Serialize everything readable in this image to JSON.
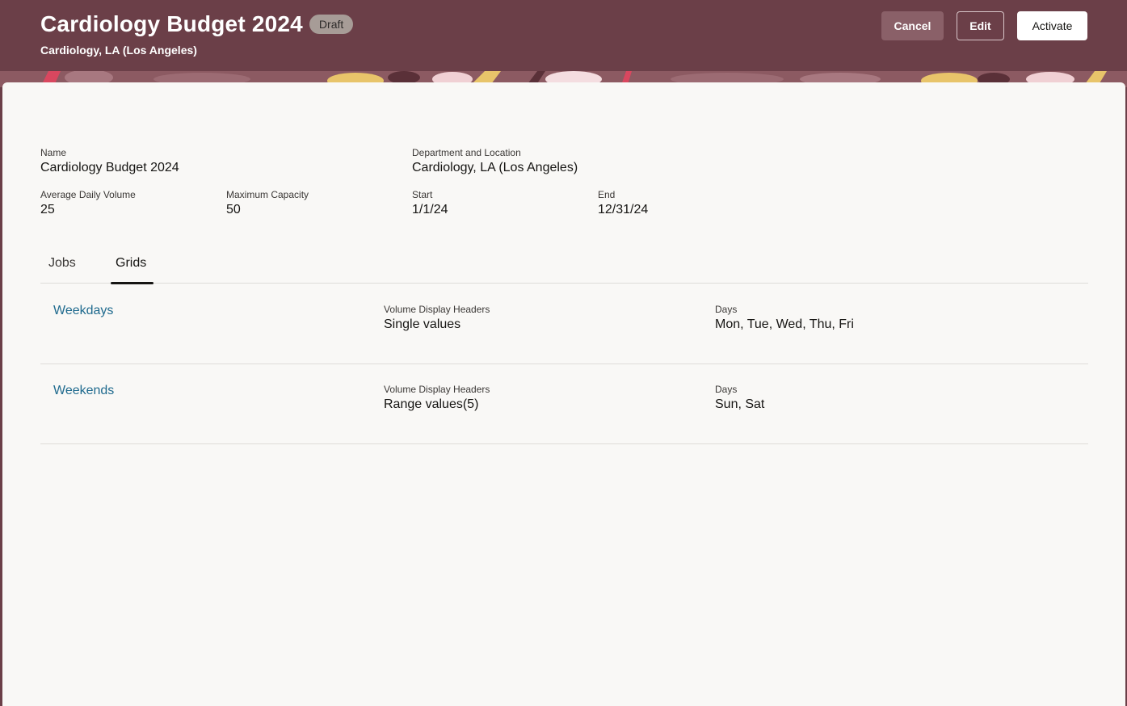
{
  "header": {
    "title": "Cardiology Budget 2024",
    "status": "Draft",
    "subtitle": "Cardiology, LA (Los Angeles)",
    "actions": {
      "cancel": "Cancel",
      "edit": "Edit",
      "activate": "Activate"
    }
  },
  "details": {
    "name": {
      "label": "Name",
      "value": "Cardiology Budget 2024"
    },
    "department": {
      "label": "Department and Location",
      "value": "Cardiology, LA (Los Angeles)"
    },
    "avg_daily_volume": {
      "label": "Average Daily Volume",
      "value": "25"
    },
    "max_capacity": {
      "label": "Maximum Capacity",
      "value": "50"
    },
    "start": {
      "label": "Start",
      "value": "1/1/24"
    },
    "end": {
      "label": "End",
      "value": "12/31/24"
    }
  },
  "tabs": [
    {
      "label": "Jobs",
      "selected": false
    },
    {
      "label": "Grids",
      "selected": true
    }
  ],
  "grids": [
    {
      "name": "Weekdays",
      "headers_label": "Volume Display Headers",
      "headers_value": "Single values",
      "days_label": "Days",
      "days_value": "Mon, Tue, Wed, Thu, Fri"
    },
    {
      "name": "Weekends",
      "headers_label": "Volume Display Headers",
      "headers_value": "Range values(5)",
      "days_label": "Days",
      "days_value": "Sun, Sat"
    }
  ],
  "colors": {
    "header_bg": "#6b3f48",
    "panel_bg": "#f9f8f6",
    "link": "#1f6a8e",
    "badge_bg": "#a79c97"
  }
}
